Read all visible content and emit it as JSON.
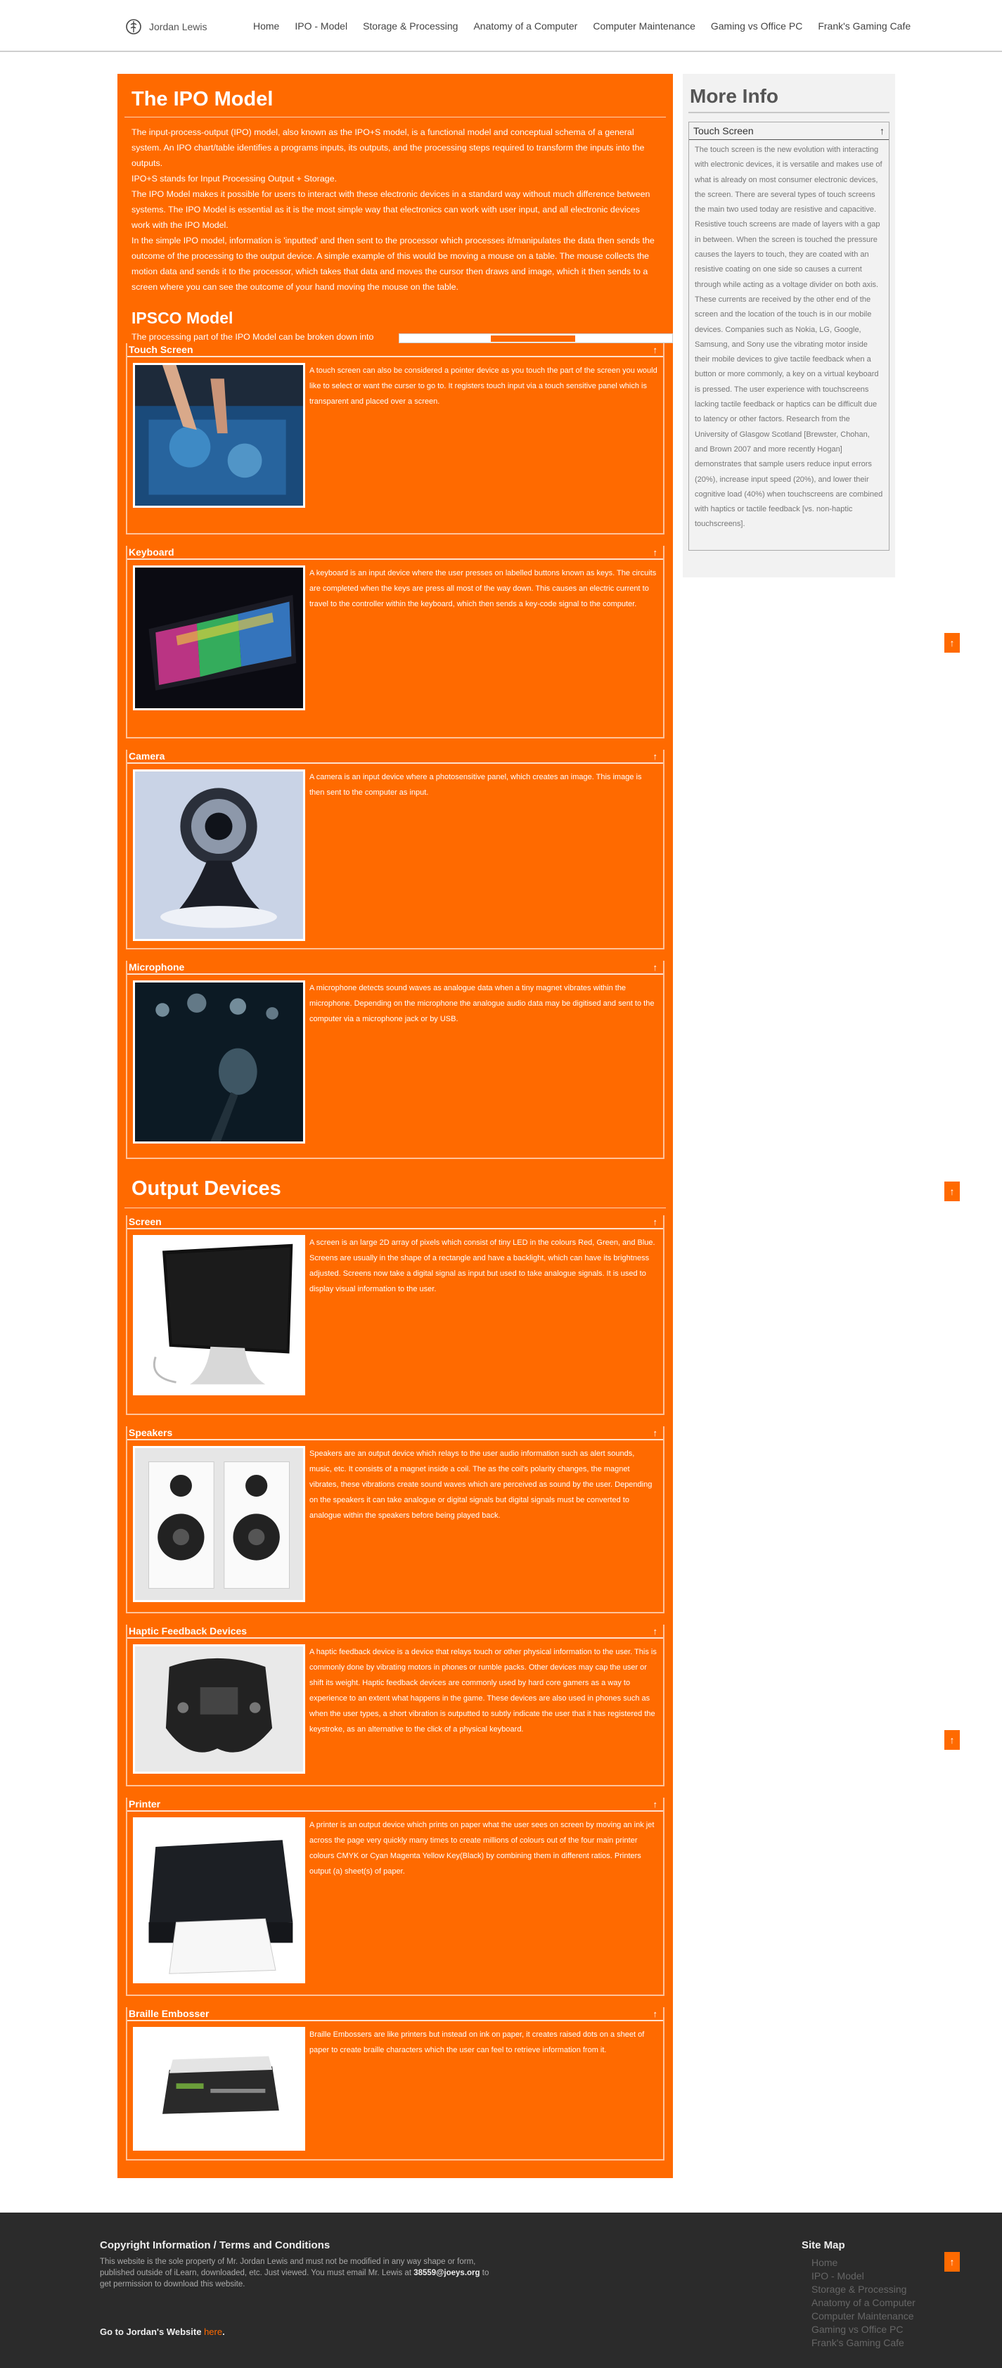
{
  "header": {
    "logo_text": "Jordan Lewis",
    "nav": [
      "Home",
      "IPO - Model",
      "Storage & Processing",
      "Anatomy of a Computer",
      "Computer Maintenance",
      "Gaming vs Office PC",
      "Frank's Gaming Cafe"
    ]
  },
  "main": {
    "title": "The IPO Model",
    "intro": [
      "The input-process-output (IPO) model, also known as the IPO+S model, is a functional model and conceptual schema of a general system. An IPO chart/table identifies a programs inputs, its outputs, and the processing steps required to transform the inputs into the outputs.",
      "IPO+S stands for Input Processing Output + Storage.",
      "The IPO Model makes it possible for users to interact with these electronic devices in a standard way without much difference between systems. The IPO Model is essential as it is the most simple way that electronics can work with user input, and all electronic devices work with the IPO Model.",
      "In the simple IPO model, information is 'inputted' and then sent to the processor which processes it/manipulates the data then sends the outcome of the processing to the output device. A simple example of this would be moving a mouse on a table. The mouse collects the motion data and sends it to the processor, which takes that data and moves the cursor then draws and image, which it then sends to a screen where you can see the outcome of your hand moving the mouse on the table."
    ],
    "ipsco_title": "IPSCO Model",
    "ipsco_text": "The processing part of the IPO Model can be broken down into",
    "input_sections": [
      {
        "title": "Touch Screen",
        "text": "A touch screen can also be considered a pointer device as you touch the part of the screen you would like to select or want the curser to go to. It registers touch input via a touch sensitive panel which is transparent and placed over a screen."
      },
      {
        "title": "Keyboard",
        "text": "A keyboard is an input device where the user presses on labelled buttons known as keys. The circuits are completed when the keys are press all most of the way down. This causes an electric current to travel to the controller within the keyboard, which then sends a key-code signal to the computer."
      },
      {
        "title": "Camera",
        "text": "A camera is an input device where a photosensitive panel, which creates an image. This image is then sent to the computer as input."
      },
      {
        "title": "Microphone",
        "text": "A microphone detects sound waves as analogue data when a tiny magnet vibrates within the microphone. Depending on the microphone the analogue audio data may be digitised and sent to the computer via a microphone jack or by USB."
      }
    ],
    "output_title": "Output Devices",
    "output_sections": [
      {
        "title": "Screen",
        "text": "A screen is an large 2D array of pixels which consist of tiny LED in the colours Red, Green, and Blue. Screens are usually in the shape of a rectangle and have a backlight, which can have its brightness adjusted. Screens now take a digital signal as input but used to take analogue signals. It is used to display visual information to the user."
      },
      {
        "title": "Speakers",
        "text": "Speakers are an output device which relays to the user audio information such as alert sounds, music, etc. It consists of a magnet inside a coil. The as the coil's polarity changes, the magnet vibrates, these vibrations create sound waves which are perceived as sound by the user. Depending on the speakers it can take analogue or digital signals but digital signals must be converted to analogue within the speakers before being played back."
      },
      {
        "title": "Haptic Feedback Devices",
        "text": "A haptic feedback device is a device that relays touch or other physical information to the user. This is commonly done by vibrating motors in phones or rumble packs. Other devices may cap the user or shift its weight. Haptic feedback devices are commonly used by hard core gamers as a way to experience to an extent what happens in the game. These devices are also used in phones such as when the user types, a short vibration is outputted to subtly indicate the user that it has registered the keystroke, as an alternative to the click of a physical keyboard."
      },
      {
        "title": "Printer",
        "text": "A printer is an output device which prints on paper what the user sees on screen by moving an ink jet across the page very quickly many times to create millions of colours out of the four main printer colours CMYK or Cyan Magenta Yellow Key(Black) by combining them in different ratios. Printers output (a) sheet(s) of paper."
      },
      {
        "title": "Braille Embosser",
        "text": "Braille Embossers are like printers but instead on ink on paper, it creates raised dots on a sheet of paper to create braille characters which the user can feel to retrieve information from it."
      }
    ],
    "arrow_glyph": "↑"
  },
  "side": {
    "title": "More Info",
    "box_title": "Touch Screen",
    "box_text": "The touch screen is the new evolution with interacting with electronic devices, it is versatile and makes use of what is already on most consumer electronic devices, the screen. There are several types of touch screens the main two used today are resistive and capacitive. Resistive touch screens are made of layers with a gap in between. When the screen is touched the pressure causes the layers to touch, they are coated with an resistive coating on one side so causes a current through while acting as a voltage divider on both axis. These currents are received by the other end of the screen and the location of the touch is in our mobile devices. Companies such as Nokia, LG, Google, Samsung, and Sony use the vibrating motor inside their mobile devices to give tactile feedback when a button or more commonly, a key on a virtual keyboard is pressed. The user experience with touchscreens lacking tactile feedback or haptics can be difficult due to latency or other factors. Research from the University of Glasgow Scotland [Brewster, Chohan, and Brown 2007 and more recently Hogan] demonstrates that sample users reduce input errors (20%), increase input speed (20%), and lower their cognitive load (40%) when touchscreens are combined with haptics or tactile feedback [vs. non-haptic touchscreens]."
  },
  "footer": {
    "copy_title": "Copyright Information / Terms and Conditions",
    "copy_text": "This website is the sole property of Mr. Jordan Lewis and must not be modified in any way shape or form, published outside of iLearn, downloaded, etc. Just viewed. You must email Mr. Lewis at",
    "copy_email": "38559@joeys.org",
    "copy_tail": "to get permission to download this website.",
    "go_label": "Go to Jordan's Website",
    "go_link": "here",
    "sitemap_title": "Site Map",
    "sitemap": [
      "Home",
      "IPO - Model",
      "Storage & Processing",
      "Anatomy of a Computer",
      "Computer Maintenance",
      "Gaming vs Office PC",
      "Frank's Gaming Cafe"
    ]
  },
  "colors": {
    "accent": "#ff6a00",
    "footer_bg": "#2b2b2b",
    "side_bg": "#f2f2f2"
  }
}
